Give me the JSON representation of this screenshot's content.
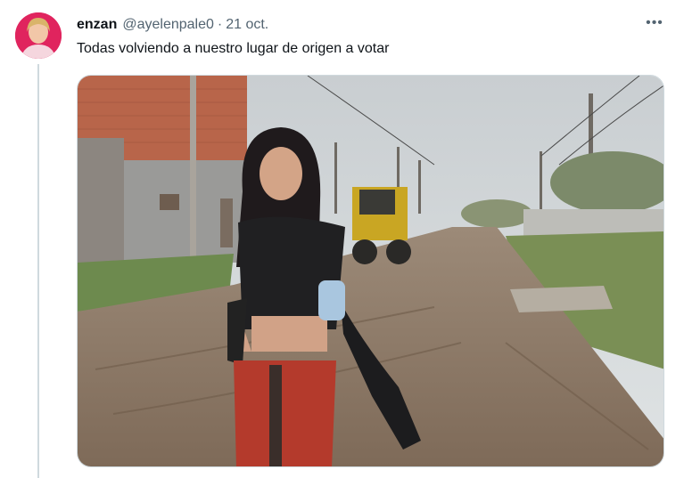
{
  "tweet": {
    "author": {
      "display_name": "enzan",
      "handle": "@ayelenpale0"
    },
    "separator": "·",
    "date": "21 oct.",
    "more_label": "•••",
    "text": "Todas volviendo a nuestro lugar de origen a votar"
  },
  "colors": {
    "text_primary": "#0f1419",
    "text_secondary": "#536471",
    "border": "#cfd9de",
    "avatar_bg": "#e0245e"
  },
  "icons": {
    "more": "more-horizontal-icon"
  }
}
